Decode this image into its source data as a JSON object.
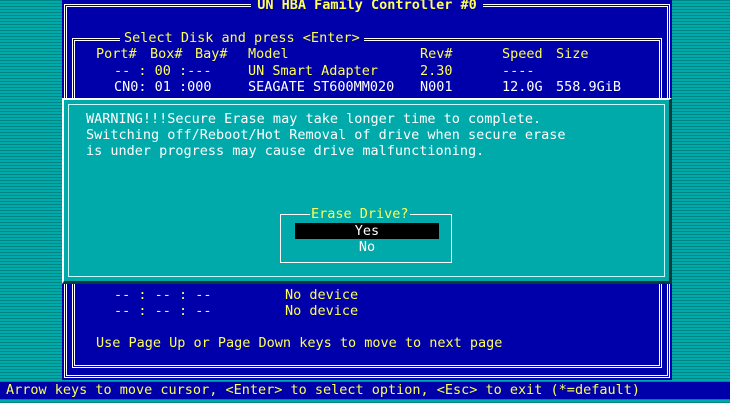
{
  "window": {
    "title": "UN HBA Family Controller #0"
  },
  "disk_list": {
    "legend": "Select Disk and press <Enter>",
    "header": {
      "port": "Port#",
      "box": "Box#",
      "bay": "Bay#",
      "model": "Model",
      "rev": "Rev#",
      "speed": "Speed",
      "size": "Size"
    },
    "rows": [
      {
        "port_box_bay": "-- : 00 :---",
        "model": "UN Smart Adapter",
        "rev": "2.30",
        "speed": "----",
        "size": ""
      },
      {
        "port_box_bay": "CN0: 01 :000",
        "model": "SEAGATE ST600MM020",
        "rev": "N001",
        "speed": "12.0G",
        "size": "558.9GiB"
      }
    ],
    "empty_rows": [
      {
        "port_box_bay": "-- : -- : --",
        "model": "No device"
      },
      {
        "port_box_bay": "-- : -- : --",
        "model": "No device"
      }
    ],
    "footer_hint": "Use Page Up or Page Down keys to move to next page"
  },
  "warning_dialog": {
    "lines": [
      "WARNING!!!Secure Erase may take longer time to complete.",
      "Switching off/Reboot/Hot Removal of drive when secure erase",
      "is under progress may cause drive malfunctioning."
    ],
    "prompt": {
      "title": "Erase Drive?",
      "options": [
        "Yes",
        "No"
      ],
      "selected": "Yes"
    }
  },
  "status_bar": "Arrow keys to move cursor, <Enter> to select option, <Esc> to exit (*=default)",
  "colors": {
    "background": "#00aaaa",
    "window": "#0000aa",
    "highlight_text": "#ffff55",
    "text": "#ffffff",
    "selection": "#000000"
  }
}
